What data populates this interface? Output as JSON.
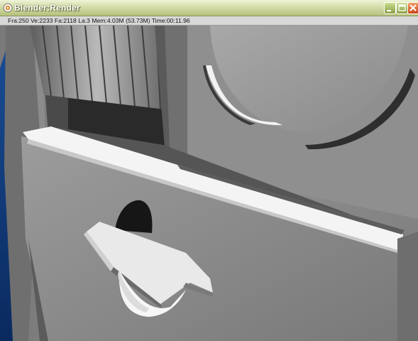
{
  "window": {
    "title": "Blender:Render",
    "buttons": {
      "minimize": "minimize-icon",
      "maximize": "maximize-icon",
      "close": "close-icon"
    },
    "colors": {
      "titlebar": "#d4dca9",
      "close": "#c9471a",
      "minmax": "#8aa046"
    }
  },
  "render_info": {
    "text": "Fra:250  Ve:2233 Fa:2118 La:3 Mem:4.03M (53.73M) Time:00:11.96"
  },
  "viewport": {
    "content": "rendered-3d-scene",
    "colors": {
      "background": "#0f3a78",
      "surface": "#8e8e8e",
      "highlight": "#f5f5f5",
      "shadow": "#2a2a2a"
    }
  }
}
